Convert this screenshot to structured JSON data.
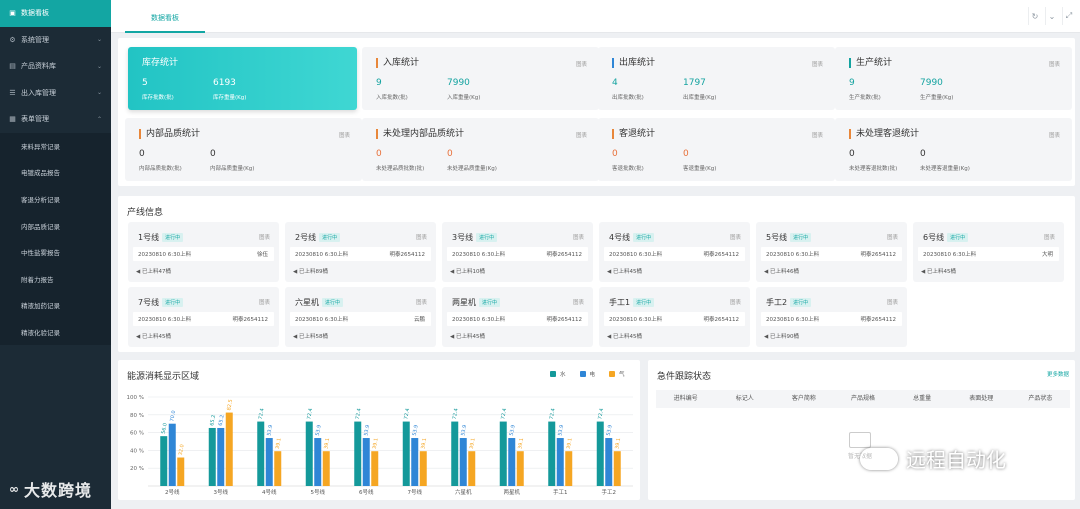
{
  "sidebar": {
    "items": [
      {
        "label": "数据看板",
        "icon": "dashboard-icon",
        "active": true
      },
      {
        "label": "系统管理",
        "icon": "gear-icon",
        "chev": "⌄"
      },
      {
        "label": "产品资料库",
        "icon": "box-icon",
        "chev": "⌄"
      },
      {
        "label": "出入库管理",
        "icon": "list-icon",
        "chev": "⌄"
      },
      {
        "label": "表单管理",
        "icon": "form-icon",
        "chev": "⌃"
      }
    ],
    "sub": [
      "来料异常记录",
      "电镀成品报告",
      "客退分析记录",
      "内部品质记录",
      "中性盐雾报告",
      "附着力报告",
      "精液加药记录",
      "精液化验记录"
    ],
    "brand": "大数跨境"
  },
  "topbar": {
    "tab": "数据看板"
  },
  "stats": [
    {
      "title": "库存统计",
      "more": "",
      "v1": "5",
      "l1": "库存批数(批)",
      "v2": "6193",
      "l2": "库存重量(Kg)"
    },
    {
      "title": "入库统计",
      "more": "图表",
      "v1": "9",
      "l1": "入库批数(批)",
      "v2": "7990",
      "l2": "入库重量(Kg)"
    },
    {
      "title": "出库统计",
      "more": "图表",
      "v1": "4",
      "l1": "出库批数(批)",
      "v2": "1797",
      "l2": "出库重量(Kg)"
    },
    {
      "title": "生产统计",
      "more": "图表",
      "v1": "9",
      "l1": "生产批数(批)",
      "v2": "7990",
      "l2": "生产重量(Kg)"
    },
    {
      "title": "内部品质统计",
      "more": "图表",
      "v1": "0",
      "l1": "内部品质批数(批)",
      "v2": "0",
      "l2": "内部品质重量(Kg)"
    },
    {
      "title": "未处理内部品质统计",
      "more": "图表",
      "v1": "0",
      "l1": "未处理品质批数(批)",
      "v2": "0",
      "l2": "未处理品质重量(Kg)"
    },
    {
      "title": "客退统计",
      "more": "图表",
      "v1": "0",
      "l1": "客退批数(批)",
      "v2": "0",
      "l2": "客退重量(Kg)"
    },
    {
      "title": "未处理客退统计",
      "more": "图表",
      "v1": "0",
      "l1": "未处理客退批数(批)",
      "v2": "0",
      "l2": "未处理客退重量(Kg)"
    }
  ],
  "lines_title": "产线信息",
  "lines": [
    {
      "name": "1号线",
      "status": "进行中",
      "more": "图表",
      "time": "20230810 6:30上料",
      "worker": "徐伍",
      "done": "已上料47桶"
    },
    {
      "name": "2号线",
      "status": "进行中",
      "more": "图表",
      "time": "20230810 6:30上料",
      "worker": "明泰2654112",
      "done": "已上料89桶"
    },
    {
      "name": "3号线",
      "status": "进行中",
      "more": "图表",
      "time": "20230810 6:30上料",
      "worker": "明泰2654112",
      "done": "已上料10桶"
    },
    {
      "name": "4号线",
      "status": "进行中",
      "more": "图表",
      "time": "20230810 6:30上料",
      "worker": "明泰2654112",
      "done": "已上料45桶"
    },
    {
      "name": "5号线",
      "status": "进行中",
      "more": "图表",
      "time": "20230810 6:30上料",
      "worker": "明泰2654112",
      "done": "已上料46桶"
    },
    {
      "name": "6号线",
      "status": "进行中",
      "more": "图表",
      "time": "20230810 6:30上料",
      "worker": "大明",
      "done": "已上料45桶"
    },
    {
      "name": "7号线",
      "status": "进行中",
      "more": "图表",
      "time": "20230810 6:30上料",
      "worker": "明泰2654112",
      "done": "已上料45桶"
    },
    {
      "name": "六星机",
      "status": "进行中",
      "more": "图表",
      "time": "20230810 6:30上料",
      "worker": "云鹏",
      "done": "已上料58桶"
    },
    {
      "name": "两星机",
      "status": "进行中",
      "more": "图表",
      "time": "20230810 6:30上料",
      "worker": "明泰2654112",
      "done": "已上料45桶"
    },
    {
      "name": "手工1",
      "status": "进行中",
      "more": "图表",
      "time": "20230810 6:30上料",
      "worker": "明泰2654112",
      "done": "已上料45桶"
    },
    {
      "name": "手工2",
      "status": "进行中",
      "more": "图表",
      "time": "20230810 6:30上料",
      "worker": "明泰2654112",
      "done": "已上料90桶"
    }
  ],
  "energy_title": "能源消耗显示区域",
  "chart_data": {
    "type": "bar",
    "categories": [
      "2号线",
      "3号线",
      "4号线",
      "5号线",
      "6号线",
      "7号线",
      "六星机",
      "两星机",
      "手工1",
      "手工2"
    ],
    "series": [
      {
        "name": "水",
        "color": "#14999a",
        "values": [
          56,
          65.2,
          72.4,
          72.4,
          72.4,
          72.4,
          72.4,
          72.4,
          72.4,
          72.4
        ]
      },
      {
        "name": "电",
        "color": "#2f86d6",
        "values": [
          70,
          65.2,
          53.9,
          53.9,
          53.9,
          53.9,
          53.9,
          53.9,
          53.9,
          53.9
        ]
      },
      {
        "name": "气",
        "color": "#f5a623",
        "values": [
          32,
          82.5,
          39.1,
          39.1,
          39.1,
          39.1,
          39.1,
          39.1,
          39.1,
          39.1
        ]
      }
    ],
    "bar_labels": [
      [
        "56.0",
        "70.0",
        "32.0"
      ],
      [
        "65.2",
        "65.2",
        "82.5"
      ],
      [
        "72.4",
        "53.9",
        "39.1"
      ],
      [
        "72.4",
        "53.9",
        "39.1"
      ],
      [
        "72.4",
        "53.9",
        "39.1"
      ],
      [
        "72.4",
        "53.9",
        "39.1"
      ],
      [
        "72.4",
        "53.9",
        "39.1"
      ],
      [
        "72.4",
        "53.9",
        "39.1"
      ],
      [
        "72.4",
        "53.9",
        "39.1"
      ],
      [
        "72.4",
        "53.9",
        "39.1"
      ]
    ],
    "yticks": [
      "100 %",
      "80 %",
      "60 %",
      "40 %",
      "20 %"
    ],
    "ylim": [
      0,
      100
    ]
  },
  "urgent": {
    "title": "急件跟踪状态",
    "more": "更多数据",
    "cols": [
      "进料编号",
      "标记人",
      "客户简称",
      "产品规格",
      "总重量",
      "表面处理",
      "产品状态"
    ],
    "empty": "暂无数据"
  },
  "watermark": "远程自动化"
}
